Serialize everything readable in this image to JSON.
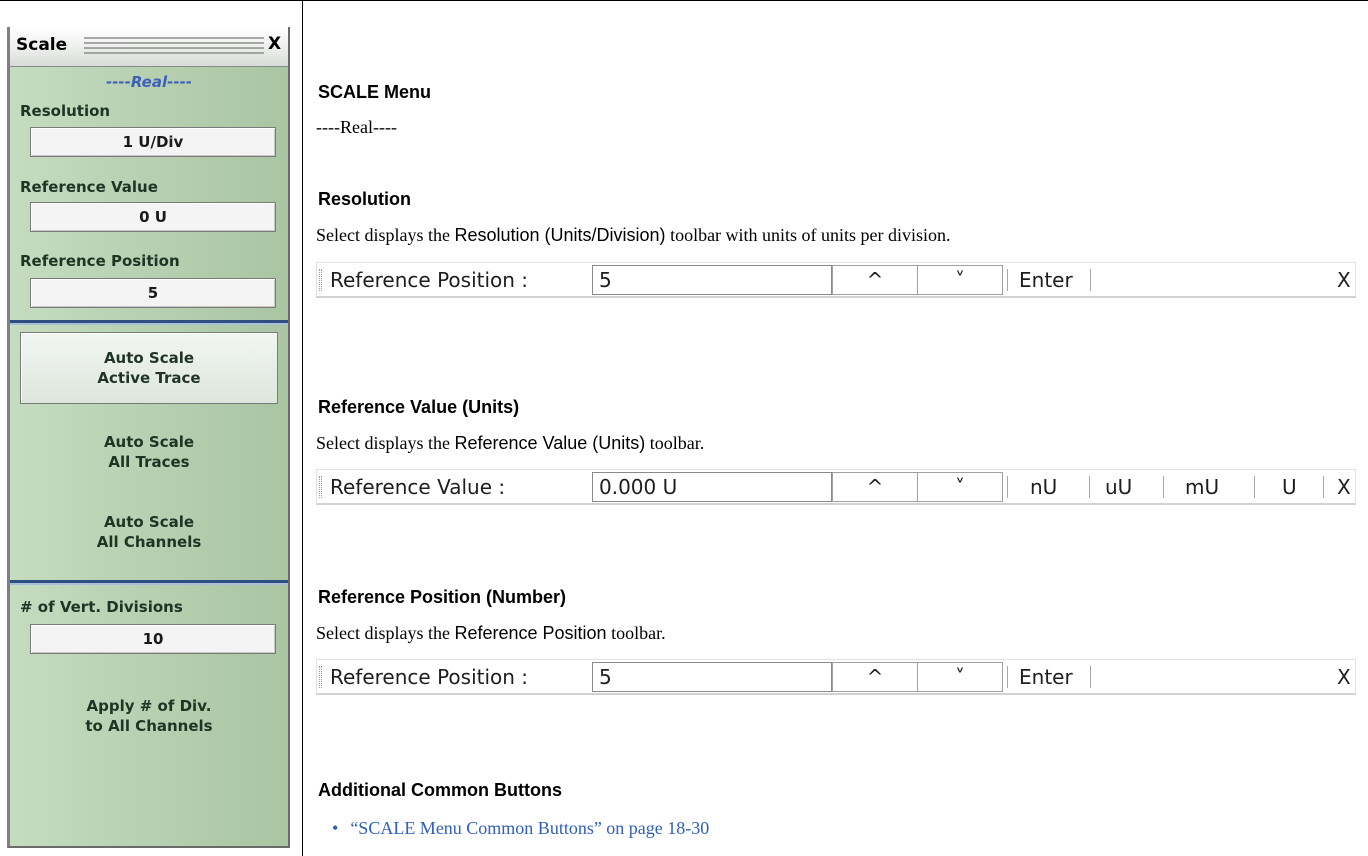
{
  "panel": {
    "title": "Scale",
    "close_label": "X",
    "section": "----Real----",
    "resolution": {
      "label": "Resolution",
      "value": "1  U/Div"
    },
    "reference_value": {
      "label": "Reference Value",
      "value": "0  U"
    },
    "reference_position": {
      "label": "Reference Position",
      "value": "5"
    },
    "auto_scale_active": {
      "line1": "Auto Scale",
      "line2": "Active Trace"
    },
    "auto_scale_all_traces": {
      "line1": "Auto Scale",
      "line2": "All Traces"
    },
    "auto_scale_all_channels": {
      "line1": "Auto Scale",
      "line2": "All Channels"
    },
    "vert_divisions": {
      "label": "# of Vert. Divisions",
      "value": "10"
    },
    "apply_divisions": {
      "line1": "Apply # of Div.",
      "line2": "to All Channels"
    }
  },
  "doc": {
    "title": "SCALE Menu",
    "section_text": "----Real----",
    "resolution": {
      "heading": "Resolution",
      "p_prefix": "Select displays the ",
      "p_sans": "Resolution (Units/Division)",
      "p_suffix": " toolbar with units of units per division."
    },
    "reference_value": {
      "heading": "Reference Value (Units)",
      "p_prefix": "Select displays the ",
      "p_sans": "Reference Value (Units)",
      "p_suffix": " toolbar."
    },
    "reference_position": {
      "heading": "Reference Position (Number)",
      "p_prefix": "Select displays the ",
      "p_sans": "Reference Position",
      "p_suffix": " toolbar."
    },
    "additional": {
      "heading": "Additional Common Buttons",
      "link_text": "“SCALE Menu Common Buttons” on page 18-30"
    }
  },
  "toolbars": {
    "tb1": {
      "label": "Reference Position  :",
      "value": "5",
      "up": "^",
      "down": "˅",
      "enter": "Enter",
      "close": "X"
    },
    "tb2": {
      "label": "Reference Value  :",
      "value": "0.000  U",
      "up": "^",
      "down": "˅",
      "units": [
        "nU",
        "uU",
        "mU",
        "U"
      ],
      "close": "X"
    },
    "tb3": {
      "label": "Reference Position  :",
      "value": "5",
      "up": "^",
      "down": "˅",
      "enter": "Enter",
      "close": "X"
    }
  }
}
